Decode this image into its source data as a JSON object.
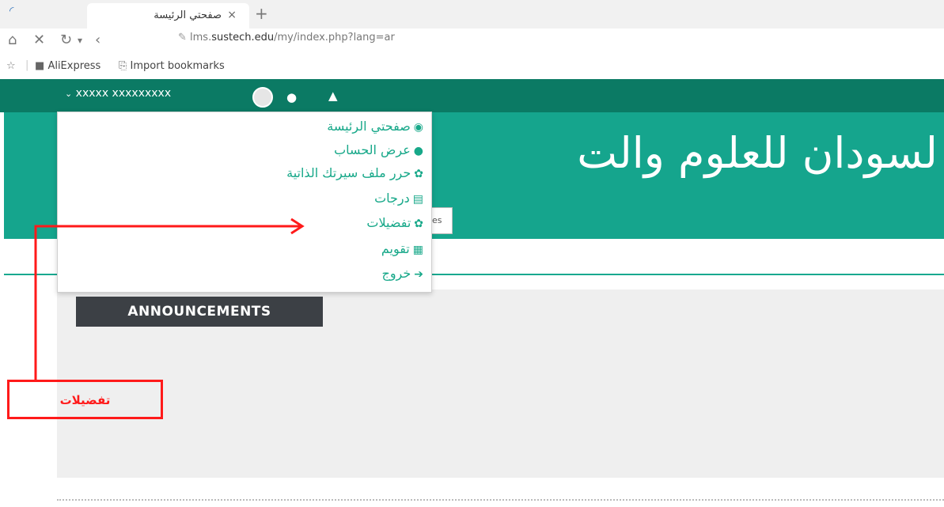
{
  "browser": {
    "tab_title": "صفحتي الرئيسة",
    "tab_close": "×",
    "new_tab": "+",
    "url_prefix": "lms.",
    "url_host": "sustech.edu",
    "url_path": "/my/index.php?lang=ar",
    "bookmarks": [
      {
        "label": "AliExpress"
      },
      {
        "label": "Import bookmarks"
      }
    ]
  },
  "navbar": {
    "username": "xxxxx xxxxxxxxx"
  },
  "header": {
    "site_title": "لسودان للعلوم والت",
    "pref_box_text": "es"
  },
  "user_menu": {
    "items": [
      {
        "label": "صفحتي الرئيسة",
        "icon": "dashboard-icon"
      },
      {
        "label": "عرض الحساب",
        "icon": "user-icon"
      },
      {
        "label": "حرر ملف سيرتك الذاتية",
        "icon": "cog-icon"
      },
      {
        "label": "درجات",
        "icon": "table-icon"
      },
      {
        "label": "تفضيلات",
        "icon": "cog-icon"
      },
      {
        "label": "تقويم",
        "icon": "calendar-icon"
      },
      {
        "label": "خروج",
        "icon": "sign-out-icon"
      }
    ]
  },
  "main": {
    "announcements_label": "ANNOUNCEMENTS"
  },
  "annotation": {
    "label": "تفضيلات",
    "color": "#ff1a1a"
  },
  "colors": {
    "navbar": "#0b7a64",
    "banner": "#15a58d",
    "menu_text": "#17a889",
    "announcements_bg": "#3c4045"
  }
}
